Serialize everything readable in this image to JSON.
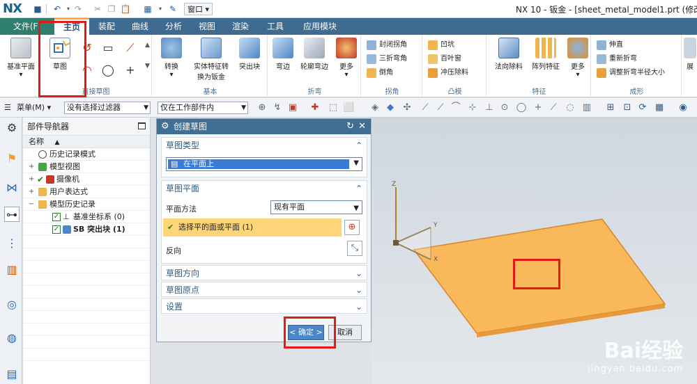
{
  "app": {
    "logo": "NX",
    "window_title": "NX 10 - 钣金 - [sheet_metal_model1.prt  (修改",
    "window_menu": "窗口"
  },
  "tabs": [
    {
      "label": "文件(F)"
    },
    {
      "label": "主页"
    },
    {
      "label": "装配"
    },
    {
      "label": "曲线"
    },
    {
      "label": "分析"
    },
    {
      "label": "视图"
    },
    {
      "label": "渲染"
    },
    {
      "label": "工具"
    },
    {
      "label": "应用模块"
    }
  ],
  "ribbon": {
    "base_plane": "基准平面",
    "sketch": "草图",
    "direct_sketch_group": "直接草图",
    "convert": "转换",
    "solid_to_sheet_l1": "实体特征转",
    "solid_to_sheet_l2": "换为钣金",
    "tab_feature": "突出块",
    "basic_group": "基本",
    "flange": "弯边",
    "contour_flange": "轮廓弯边",
    "more1": "更多",
    "bend_group": "折弯",
    "closed_corner": "封闭拐角",
    "three_bend_corner": "三折弯角",
    "chamfer": "倒角",
    "corner_group": "拐角",
    "dimple": "凹坑",
    "louver": "百叶窗",
    "punch": "冲压除料",
    "emboss_group": "凸模",
    "normal_cutout": "法向除料",
    "pattern_feature": "阵列特征",
    "more2": "更多",
    "feature_group": "特征",
    "unbend": "伸直",
    "rebend": "重新折弯",
    "adjust_bend_radius": "调整折弯半径大小",
    "form_group": "成形",
    "expand_more": "展"
  },
  "toolbar2": {
    "menu_label": "菜单(M)",
    "filter_value": "没有选择过滤器",
    "scope_value": "仅在工作部件内"
  },
  "navigator": {
    "title": "部件导航器",
    "column_name": "名称",
    "items": [
      {
        "label": "历史记录模式"
      },
      {
        "label": "模型视图"
      },
      {
        "label": "摄像机"
      },
      {
        "label": "用户表达式"
      },
      {
        "label": "模型历史记录"
      },
      {
        "label": "基准坐标系 (0)"
      },
      {
        "label": "SB 突出块 (1)"
      }
    ]
  },
  "dialog": {
    "title": "创建草图",
    "sec_type": "草图类型",
    "type_value": "在平面上",
    "sec_plane": "草图平面",
    "plane_method_label": "平面方法",
    "plane_method_value": "现有平面",
    "select_face": "选择平的面或平面 (1)",
    "reverse_label": "反向",
    "sec_direction": "草图方向",
    "sec_origin": "草图原点",
    "sec_settings": "设置",
    "ok_button": "< 确定 >",
    "cancel_button": "取消"
  },
  "viewport": {
    "axis_z": "Z",
    "axis_y": "Y",
    "axis_x": "X",
    "watermark_main": "Bai经验",
    "watermark_sub": "jingyan.baidu.com"
  },
  "colors": {
    "tab_bar": "#3e6b8f",
    "file_tab": "#2f7f6f",
    "dialog_title": "#3f6f93",
    "selected_row": "#ffd57a",
    "plate_fill": "#f9b85a",
    "highlight_box": "#e21a1a"
  }
}
